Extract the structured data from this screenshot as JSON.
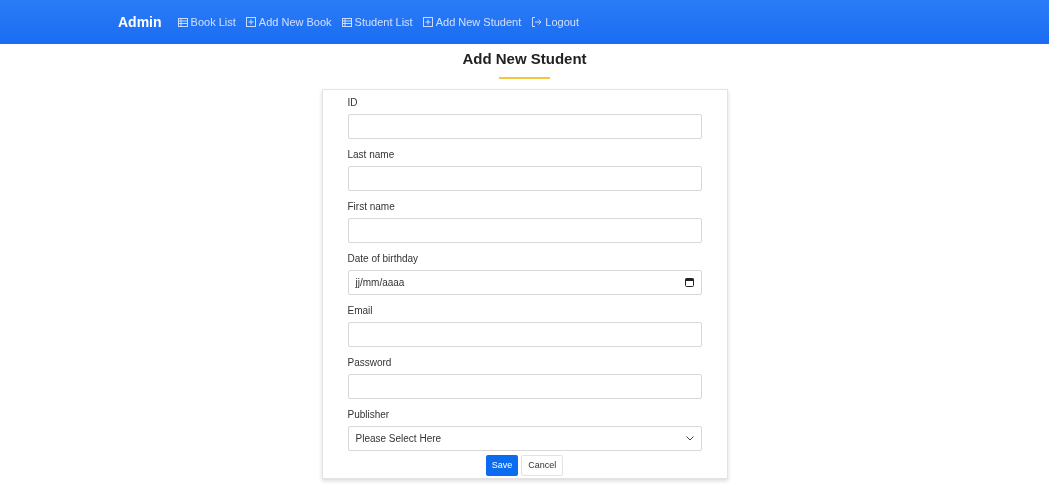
{
  "navbar": {
    "brand": "Admin",
    "items": [
      {
        "label": "Book List",
        "kind": "list"
      },
      {
        "label": "Add New Book",
        "kind": "add"
      },
      {
        "label": "Student List",
        "kind": "list"
      },
      {
        "label": "Add New Student",
        "kind": "add"
      },
      {
        "label": "Logout",
        "kind": "logout"
      }
    ]
  },
  "page_title": "Add New Student",
  "form": {
    "fields": [
      {
        "label": "ID",
        "kind": "text"
      },
      {
        "label": "Last name",
        "kind": "text"
      },
      {
        "label": "First name",
        "kind": "text"
      },
      {
        "label": "Date of birthday",
        "kind": "date",
        "placeholder": "jj/mm/aaaa"
      },
      {
        "label": "Email",
        "kind": "text"
      },
      {
        "label": "Password",
        "kind": "text"
      },
      {
        "label": "Publisher",
        "kind": "select",
        "value": "Please Select Here"
      }
    ],
    "buttons": [
      {
        "label": "Save",
        "kind": "primary"
      },
      {
        "label": "Cancel",
        "kind": "secondary"
      }
    ]
  }
}
